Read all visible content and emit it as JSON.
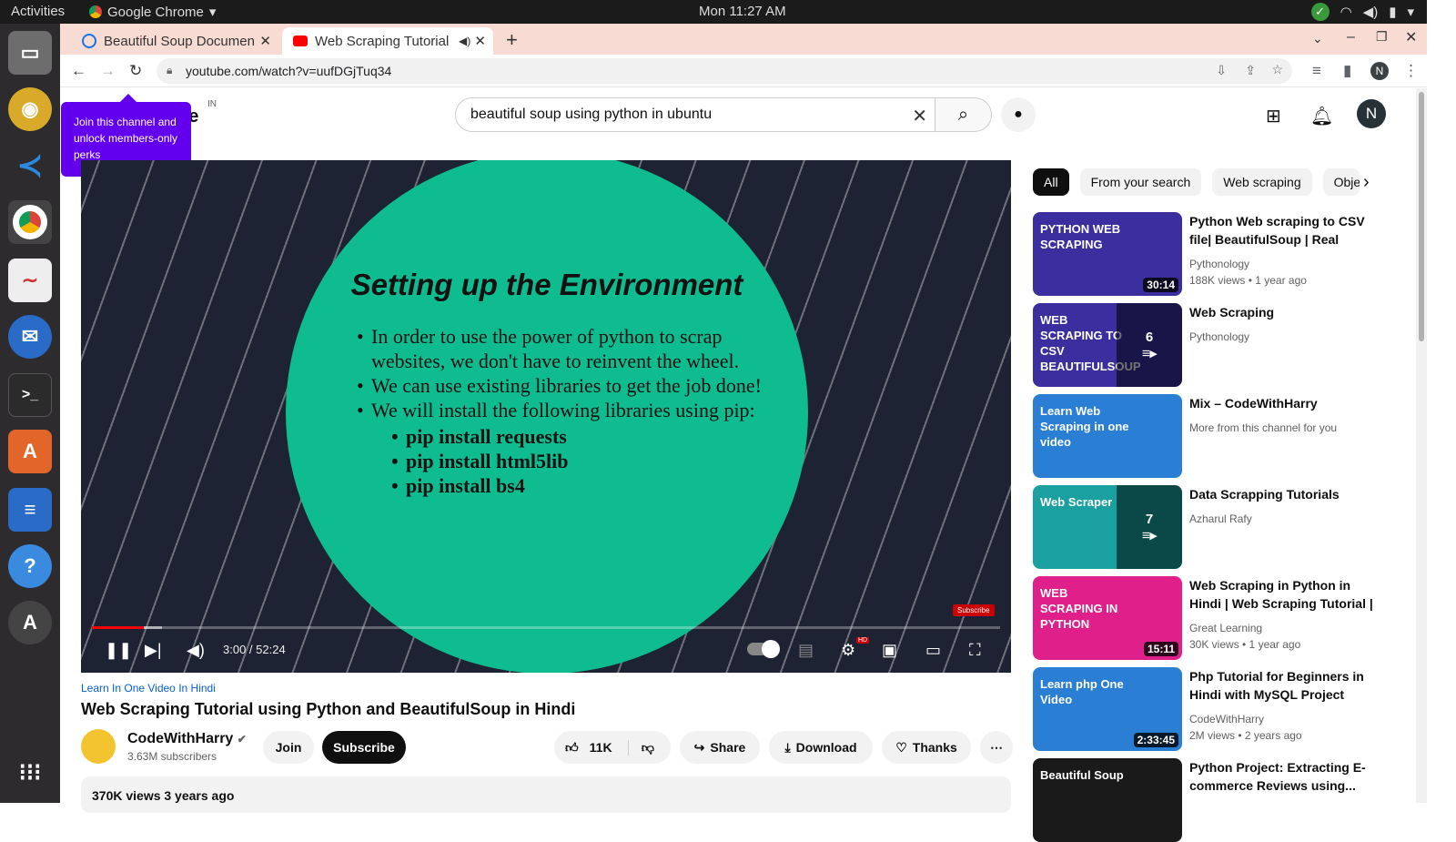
{
  "os": {
    "activities": "Activities",
    "app_name": "Google Chrome",
    "clock": "Mon 11:27 AM"
  },
  "browser": {
    "tabs": [
      {
        "title": "Beautiful Soup Documen"
      },
      {
        "title": "Web Scraping Tutorial"
      }
    ],
    "url": "youtube.com/watch?v=uufDGjTuq34",
    "profile_initial": "N"
  },
  "youtube": {
    "logo_suffix": "be",
    "country": "IN",
    "search_value": "beautiful soup using python in ubuntu",
    "avatar_initial": "N",
    "tooltip": "Join this channel and unlock members-only perks",
    "player": {
      "slide_title": "Setting up the Environment",
      "bullets": [
        "In order to use the power of python to scrap websites, we don't have to reinvent the wheel.",
        "We can use existing libraries to get the job done!",
        "We will install the following libraries using pip:"
      ],
      "sub_bullets": [
        "pip install requests",
        "pip install html5lib",
        "pip install bs4"
      ],
      "watermark": "Subscribe",
      "time": "3:00 / 52:24",
      "progress_fraction": 0.057,
      "buffered_fraction": 0.077,
      "hd_badge": "HD"
    },
    "video": {
      "playlist_link": "Learn In One Video In Hindi",
      "title": "Web Scraping Tutorial using Python and BeautifulSoup in Hindi",
      "channel": "CodeWithHarry",
      "subscribers": "3.63M subscribers",
      "join_label": "Join",
      "subscribe_label": "Subscribe",
      "likes": "11K",
      "share_label": "Share",
      "download_label": "Download",
      "thanks_label": "Thanks",
      "views_date": "370K views  3 years ago"
    },
    "chips": [
      "All",
      "From your search",
      "Web scraping",
      "Obje"
    ],
    "recommendations": [
      {
        "title": "Python Web scraping to CSV file| BeautifulSoup | Real Estat...",
        "channel": "Pythonology",
        "meta": "188K views  • 1 year ago",
        "duration": "30:14",
        "thumb_text": "PYTHON WEB SCRAPING",
        "thumb_color": "#3b2fa0"
      },
      {
        "title": "Web Scraping",
        "channel": "Pythonology",
        "meta": "",
        "playlist_count": "6",
        "thumb_text": "WEB SCRAPING TO CSV BEAUTIFULSOUP",
        "thumb_color": "#3b2fa0"
      },
      {
        "title": "Mix – CodeWithHarry",
        "channel": "More from this channel for you",
        "meta": "",
        "thumb_text": "Learn Web Scraping in one video",
        "thumb_color": "#2a7fd4"
      },
      {
        "title": "Data Scrapping Tutorials",
        "channel": "Azharul Rafy",
        "meta": "",
        "playlist_count": "7",
        "thumb_text": "Web Scraper",
        "thumb_color": "#1aa0a0"
      },
      {
        "title": "Web Scraping in Python in Hindi | Web Scraping Tutorial | Learn...",
        "channel": "Great Learning",
        "meta": "30K views  • 1 year ago",
        "duration": "15:11",
        "thumb_text": "WEB SCRAPING IN PYTHON",
        "thumb_color": "#e0208a"
      },
      {
        "title": "Php Tutorial for Beginners in Hindi with MySQL Project",
        "channel": "CodeWithHarry",
        "meta": "2M views  • 2 years ago",
        "duration": "2:33:45",
        "thumb_text": "Learn php One Video",
        "thumb_color": "#2a7fd4"
      },
      {
        "title": "Python Project: Extracting E-commerce Reviews using...",
        "channel": "",
        "meta": "",
        "thumb_text": "Beautiful Soup",
        "thumb_color": "#1a1a1a"
      }
    ]
  }
}
